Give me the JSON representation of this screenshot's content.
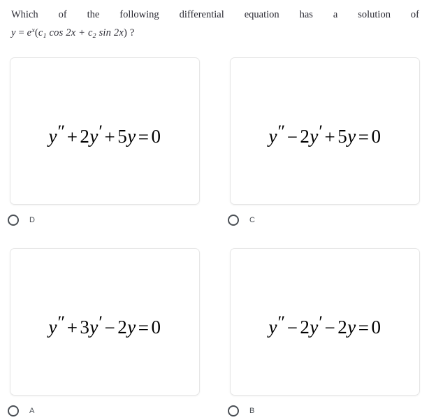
{
  "question": {
    "line1": "Which of the following differential equation has a solution of",
    "line2_plain": "y = e^x(c_1 cos 2x + c_2 sin 2x) ?",
    "line2": {
      "lhs_var": "y",
      "equals": " = ",
      "base": "e",
      "exponent": "x",
      "open_paren": "(",
      "coef1": "c",
      "coef1_sub": "1",
      "cos_term": " cos 2x + ",
      "coef2": "c",
      "coef2_sub": "2",
      "sin_term": " sin 2x",
      "close_paren": ") ?"
    }
  },
  "options": [
    {
      "id": "option-d",
      "label": "D",
      "equation_plain": "y″ + 2y′ + 5y = 0",
      "equation": {
        "term1_var": "y",
        "term1_prime": "″",
        "op1": "+",
        "term2_coef": "2",
        "term2_var": "y",
        "term2_prime": "′",
        "op2": "+",
        "term3_coef": "5",
        "term3_var": "y",
        "equals": "=",
        "rhs": "0"
      }
    },
    {
      "id": "option-c",
      "label": "C",
      "equation_plain": "y″ − 2y′ + 5y = 0",
      "equation": {
        "term1_var": "y",
        "term1_prime": "″",
        "op1": "−",
        "term2_coef": "2",
        "term2_var": "y",
        "term2_prime": "′",
        "op2": "+",
        "term3_coef": "5",
        "term3_var": "y",
        "equals": "=",
        "rhs": "0"
      }
    },
    {
      "id": "option-a",
      "label": "A",
      "equation_plain": "y″ + 3y′ − 2y = 0",
      "equation": {
        "term1_var": "y",
        "term1_prime": "″",
        "op1": "+",
        "term2_coef": "3",
        "term2_var": "y",
        "term2_prime": "′",
        "op2": "−",
        "term3_coef": "2",
        "term3_var": "y",
        "equals": "=",
        "rhs": "0"
      }
    },
    {
      "id": "option-b",
      "label": "B",
      "equation_plain": "y″ − 2y′ − 2y = 0",
      "equation": {
        "term1_var": "y",
        "term1_prime": "″",
        "op1": "−",
        "term2_coef": "2",
        "term2_var": "y",
        "term2_prime": "′",
        "op2": "−",
        "term3_coef": "2",
        "term3_var": "y",
        "equals": "=",
        "rhs": "0"
      }
    }
  ],
  "colors": {
    "text": "#2a2a33",
    "equation": "#000000",
    "card_border": "#e6e6e6",
    "radio_border": "#4a4f55",
    "label": "#4a4f55",
    "background": "#ffffff"
  }
}
